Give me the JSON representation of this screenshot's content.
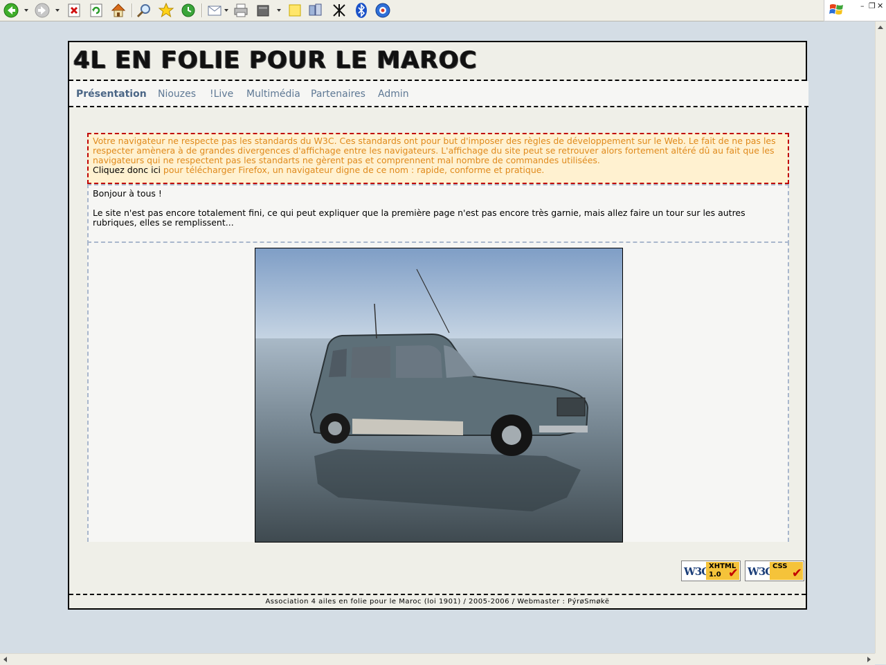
{
  "browser": {
    "toolbar_icons": [
      "back-icon",
      "forward-icon",
      "stop-icon",
      "refresh-icon",
      "home-icon",
      "search-icon",
      "favorites-icon",
      "history-icon",
      "mail-icon",
      "print-icon",
      "edit-icon",
      "note-icon",
      "messenger-icon",
      "tool-icon",
      "bluetooth-icon",
      "settings-icon"
    ],
    "window_buttons": {
      "minimize": "–",
      "restore": "❐",
      "close": "✕"
    }
  },
  "site": {
    "title": "4L EN FOLIE POUR LE MAROC",
    "nav": [
      {
        "label": "Présentation",
        "active": true
      },
      {
        "label": "Niouzes"
      },
      {
        "label": "!Live"
      },
      {
        "label": "Multimédia"
      },
      {
        "label": "Partenaires"
      },
      {
        "label": "Admin"
      }
    ]
  },
  "warning": {
    "text": "Votre navigateur ne respecte pas les standards du W3C. Ces standards ont pour but d'imposer des règles de développement sur le Web. Le fait de ne pas les respecter amènera à de grandes divergences d'affichage entre les navigateurs. L'affichage du site peut se retrouver alors fortement altéré dû au fait que les navigateurs qui ne respectent pas les standarts ne gèrent pas et comprennent mal nombre de commandes utilisées.",
    "click_prefix": "Cliquez donc ici",
    "link_text": "pour télécharger Firefox, un navigateur digne de ce nom : rapide, conforme et pratique."
  },
  "intro": {
    "greeting": "Bonjour à tous !",
    "body": "Le site n'est pas encore totalement fini, ce qui peut expliquer que la première page n'est pas encore très garnie, mais allez faire un tour sur les autres rubriques, elles se remplissent..."
  },
  "badges": [
    {
      "w3c": "W3C",
      "label_line1": "XHTML",
      "label_line2": "1.0"
    },
    {
      "w3c": "W3C",
      "label_line1": "CSS",
      "label_line2": ""
    }
  ],
  "footer": "Association 4 ailes en folie pour le Maroc (loi 1901) / 2005-2006 / Webmaster : PýrøSmøkë"
}
